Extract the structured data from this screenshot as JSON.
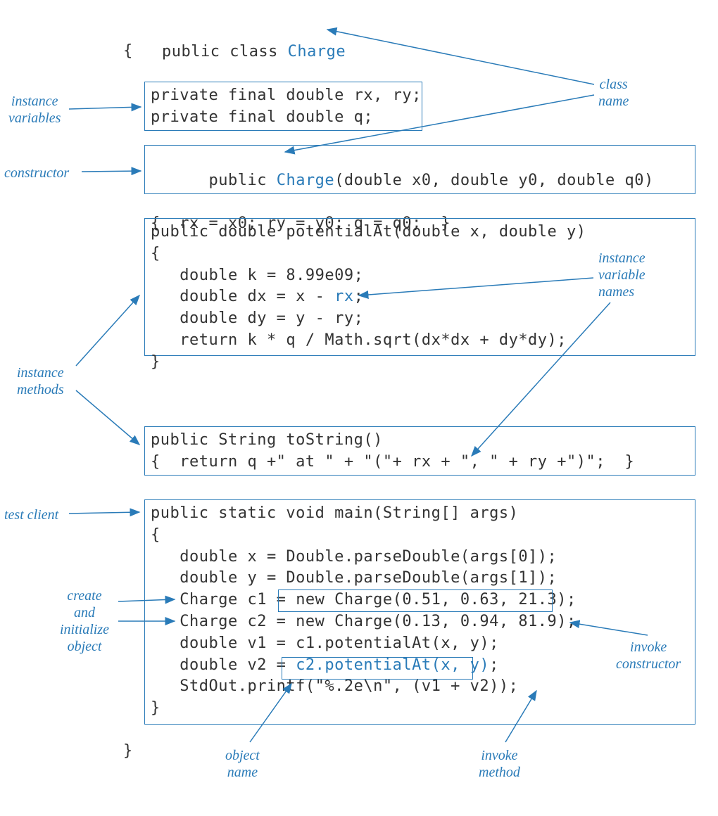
{
  "code": {
    "class_keyword": "public class ",
    "class_name": "Charge",
    "open_brace": "{",
    "close_brace": "}",
    "instance_vars_line1": "private final double rx, ry;",
    "instance_vars_line2": "private final double q;",
    "constructor_sig_pre": "public ",
    "constructor_name": "Charge",
    "constructor_sig_post": "(double x0, double y0, double q0)",
    "constructor_body": "{  rx = x0; ry = y0; q = q0;  }",
    "method1_sig": "public double potentialAt(double x, double y)",
    "method1_open": "{",
    "method1_line1a": "   double k = 8.99e09;",
    "method1_line2a": "   double dx = x - ",
    "method1_line2_rx": "rx",
    "method1_line2b": ";",
    "method1_line3": "   double dy = y - ry;",
    "method1_line4": "   return k * q / Math.sqrt(dx*dx + dy*dy);",
    "method1_close": "}",
    "method2_sig": "public String toString()",
    "method2_body": "{  return q +\" at \" + \"(\"+ rx + \", \" + ry +\")\";  }",
    "main_sig": "public static void main(String[] args)",
    "main_open": "{",
    "main_line1": "   double x = Double.parseDouble(args[0]);",
    "main_line2": "   double y = Double.parseDouble(args[1]);",
    "main_line3a": "   Charge c1 = ",
    "main_line3b": "new Charge(0.51, 0.63, 21.3);",
    "main_line4": "   Charge c2 = new Charge(0.13, 0.94, 81.9);",
    "main_line5": "   double v1 = c1.potentialAt(x, y);",
    "main_line6a": "   double v2 = ",
    "main_line6b": "c2.potentialAt(x, y)",
    "main_line6c": ";",
    "main_line7": "   StdOut.printf(\"%.2e\\n\", (v1 + v2));",
    "main_close": "}"
  },
  "labels": {
    "instance_variables": "instance\nvariables",
    "class_name": "class\nname",
    "constructor": "constructor",
    "instance_methods": "instance\nmethods",
    "instance_variable_names": "instance\nvariable\nnames",
    "test_client": "test client",
    "create_and_initialize_object": "create\nand\ninitialize\nobject",
    "invoke_constructor": "invoke\nconstructor",
    "object_name": "object\nname",
    "invoke_method": "invoke\nmethod"
  }
}
